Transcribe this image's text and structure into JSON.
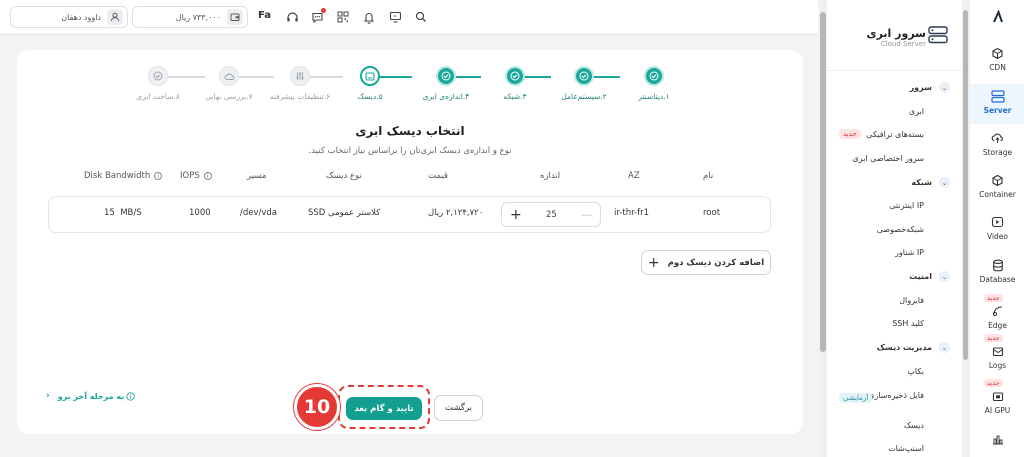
{
  "topbar": {
    "user_name": "داوود دهقان",
    "balance": "۷۳۳,۰۰۰ ریال",
    "lang": "Fa"
  },
  "stepper": [
    {
      "label": "۱.دیتاسنتر",
      "state": "done"
    },
    {
      "label": "۲.سیستم‌عامل",
      "state": "done"
    },
    {
      "label": "۳.شبکه",
      "state": "done"
    },
    {
      "label": "۴.اندازه‌ی ابری",
      "state": "done"
    },
    {
      "label": "۵.دیسک",
      "state": "current"
    },
    {
      "label": "۶.تنظیمات پیشرفته",
      "state": "todo"
    },
    {
      "label": "۷.بررسی نهایی",
      "state": "todo"
    },
    {
      "label": "۸.ساخت ابری",
      "state": "todo"
    }
  ],
  "section": {
    "title": "انتخاب دیسک ابری",
    "subtitle": "نوع و اندازه‌ی دیسک ابری‌تان را براساس نیاز انتخاب کنید."
  },
  "table": {
    "headers": {
      "name": "نام",
      "az": "AZ",
      "size": "اندازه",
      "price": "قیمت",
      "type": "نوع دیسک",
      "path": "مسیر",
      "iops": "IOPS",
      "bandwidth": "Disk Bandwidth"
    },
    "row": {
      "name": "root",
      "az": "ir-thr-fr1",
      "size": "25",
      "price": "۲,۱۲۴,۷۲۰ ریال",
      "type": "SSD کلاستر عمومی",
      "path": "/dev/vda",
      "iops": "1000",
      "bandwidth": "15  MB/S"
    }
  },
  "buttons": {
    "add_disk": "اضافه کردن دیسک دوم",
    "next": "تایید و گام بعد",
    "back": "برگشت",
    "last_step": "به مرحله آخر برو",
    "annotation": "10"
  },
  "menu": {
    "title": "سرور ابری",
    "subtitle": "Cloud Server",
    "groups": [
      {
        "label": "سرور",
        "items": [
          {
            "label": "ابری"
          },
          {
            "label": "بسته‌های ترافیکی",
            "tag": "جدید"
          },
          {
            "label": "سرور اختصاصی ابری"
          }
        ]
      },
      {
        "label": "شبکه",
        "items": [
          {
            "label": "IP اینترنتی"
          },
          {
            "label": "شبکه‌خصوصی"
          },
          {
            "label": "IP شناور"
          }
        ]
      },
      {
        "label": "امنیت",
        "items": [
          {
            "label": "فایروال"
          },
          {
            "label": "کلید SSH"
          }
        ]
      },
      {
        "label": "مدیریت دیسک",
        "items": [
          {
            "label": "بکاپ"
          },
          {
            "label": "فایل ذخیره‌سازی",
            "tag": "آزمایشی"
          },
          {
            "label": "دیسک"
          },
          {
            "label": "اسنپ‌شات"
          }
        ]
      }
    ]
  },
  "rail": [
    {
      "label": "CDN",
      "icon": "cdn-icon"
    },
    {
      "label": "Server",
      "icon": "server-icon",
      "active": true
    },
    {
      "label": "Storage",
      "icon": "storage-icon"
    },
    {
      "label": "Container",
      "icon": "container-icon"
    },
    {
      "label": "Video",
      "icon": "video-icon"
    },
    {
      "label": "Database",
      "icon": "database-icon"
    },
    {
      "label": "Edge",
      "icon": "edge-icon",
      "tag": "جدید"
    },
    {
      "label": "Logs",
      "icon": "logs-icon",
      "tag": "جدید"
    },
    {
      "label": "AI GPU",
      "icon": "gpu-icon",
      "tag": "جدید"
    }
  ],
  "colors": {
    "accent": "#1aa89a",
    "primary_button": "#139e92",
    "annotation": "#e53935",
    "active_rail": "#1f6fd1"
  }
}
